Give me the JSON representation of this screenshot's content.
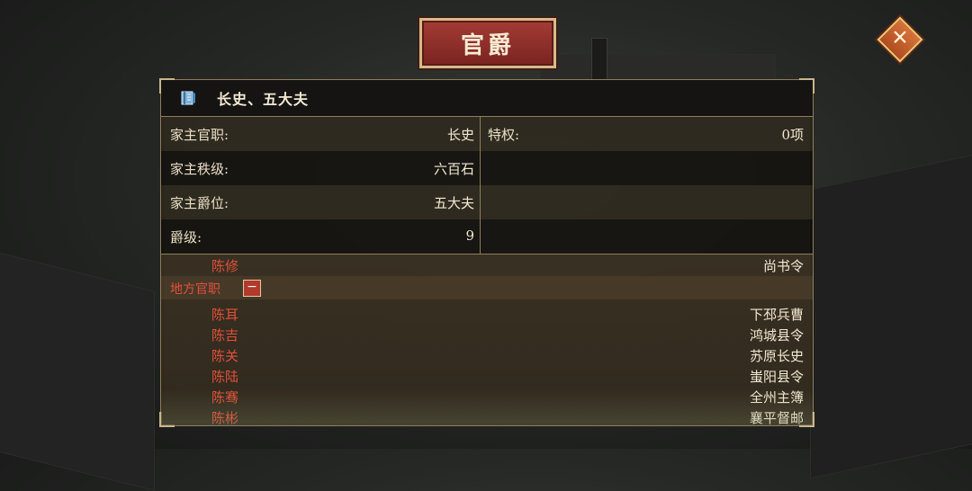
{
  "title": "官爵",
  "header": {
    "rank_title": "长史、五大夫"
  },
  "info": {
    "rows": [
      {
        "label": "家主官职:",
        "value": "长史"
      },
      {
        "label": "家主秩级:",
        "value": "六百石"
      },
      {
        "label": "家主爵位:",
        "value": "五大夫"
      },
      {
        "label": "爵级:",
        "value": "9"
      }
    ],
    "privilege": {
      "label": "特权:",
      "value": "0项"
    }
  },
  "court_official": {
    "name": "陈修",
    "post": "尚书令"
  },
  "local_category": {
    "label": "地方官职",
    "toggle": "−"
  },
  "local_officials": [
    {
      "name": "陈耳",
      "post": "下邳兵曹"
    },
    {
      "name": "陈吉",
      "post": "鸿城县令"
    },
    {
      "name": "陈关",
      "post": "苏原长史"
    },
    {
      "name": "陈陆",
      "post": "蚩阳县令"
    },
    {
      "name": "陈骞",
      "post": "全州主簿"
    },
    {
      "name": "陈彬",
      "post": "襄平督邮"
    }
  ],
  "colors": {
    "accent_red": "#e2503a",
    "border_gold": "#8e7d5c",
    "plaque": "#a33c35"
  },
  "icons": {
    "close": "close-icon",
    "header": "book-icon"
  }
}
